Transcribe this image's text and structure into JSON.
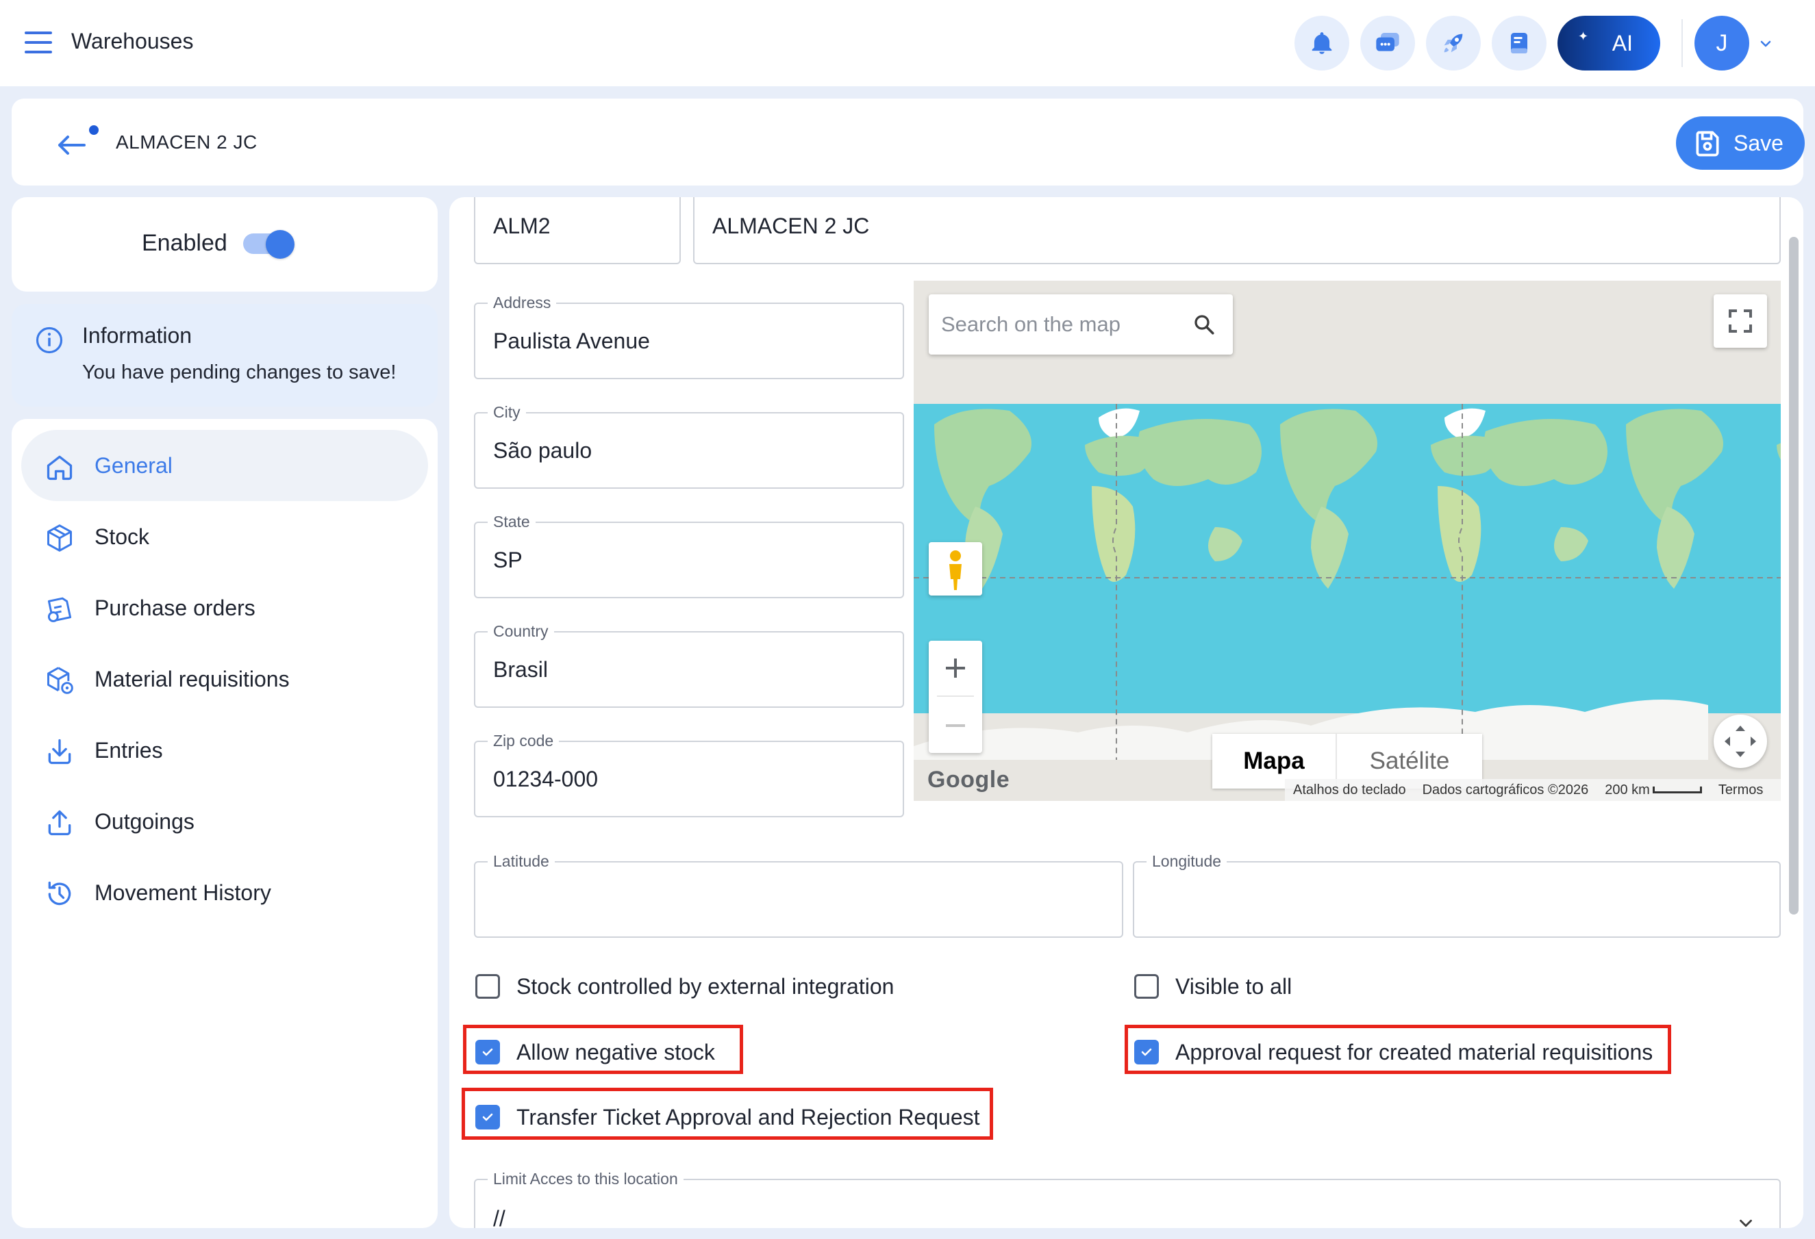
{
  "topbar": {
    "title": "Warehouses",
    "icons": [
      "bell-icon",
      "chat-icon",
      "rocket-icon",
      "notes-icon"
    ],
    "ai_label": "AI",
    "avatar_initial": "J"
  },
  "header": {
    "title": "ALMACEN 2 JC",
    "save_label": "Save"
  },
  "status": {
    "enabled_label": "Enabled",
    "enabled": true
  },
  "info": {
    "title": "Information",
    "text": "You have pending changes to save!"
  },
  "nav": {
    "items": [
      {
        "label": "General",
        "icon": "home-icon",
        "active": true
      },
      {
        "label": "Stock",
        "icon": "box-icon",
        "active": false
      },
      {
        "label": "Purchase orders",
        "icon": "purchase-order-icon",
        "active": false
      },
      {
        "label": "Material requisitions",
        "icon": "box-settings-icon",
        "active": false
      },
      {
        "label": "Entries",
        "icon": "download-icon",
        "active": false
      },
      {
        "label": "Outgoings",
        "icon": "upload-icon",
        "active": false
      },
      {
        "label": "Movement History",
        "icon": "history-icon",
        "active": false
      }
    ]
  },
  "form": {
    "code": {
      "value": "ALM2"
    },
    "name": {
      "value": "ALMACEN 2 JC"
    },
    "address": {
      "label": "Address",
      "value": "Paulista Avenue"
    },
    "city": {
      "label": "City",
      "value": "São paulo"
    },
    "state": {
      "label": "State",
      "value": "SP"
    },
    "country": {
      "label": "Country",
      "value": "Brasil"
    },
    "zip": {
      "label": "Zip code",
      "value": "01234-000"
    },
    "latitude": {
      "label": "Latitude",
      "value": ""
    },
    "longitude": {
      "label": "Longitude",
      "value": ""
    },
    "checkboxes": {
      "external_integration": {
        "label": "Stock controlled by external integration",
        "checked": false
      },
      "visible_to_all": {
        "label": "Visible to all",
        "checked": false
      },
      "negative_stock": {
        "label": "Allow negative stock",
        "checked": true
      },
      "approval_requisitions": {
        "label": "Approval request for created material requisitions",
        "checked": true
      },
      "transfer_ticket": {
        "label": "Transfer Ticket Approval and Rejection Request",
        "checked": true
      }
    },
    "limit_access": {
      "label": "Limit Acces to this location",
      "value": "//"
    }
  },
  "map": {
    "search_placeholder": "Search on the map",
    "type_map": "Mapa",
    "type_satellite": "Satélite",
    "logo": "Google",
    "attribution": {
      "shortcuts": "Atalhos do teclado",
      "data": "Dados cartográficos ©2026",
      "scale": "200 km",
      "terms": "Termos"
    }
  },
  "colors": {
    "accent": "#3b7ae8",
    "highlight": "#e8231a",
    "ocean": "#58cbe0",
    "land": "#a9d7a3"
  }
}
